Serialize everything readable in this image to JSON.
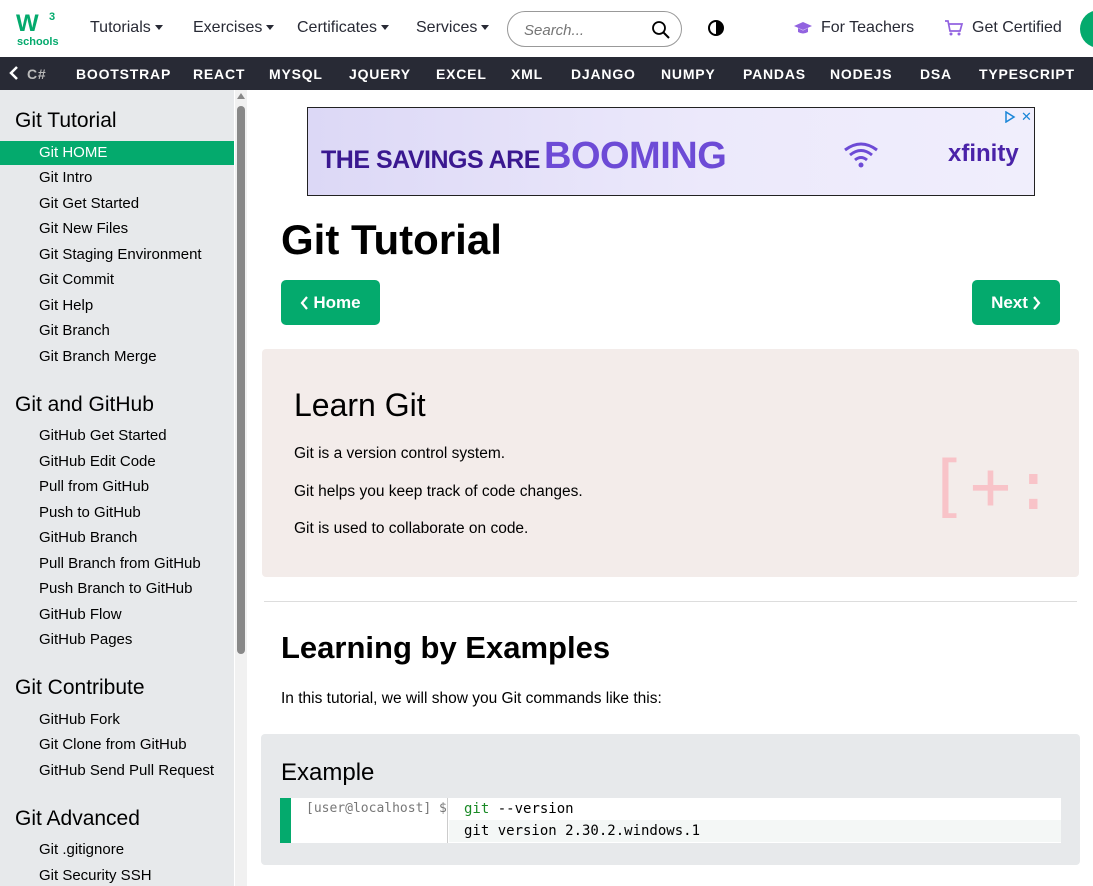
{
  "topnav": {
    "logo_text": "schools",
    "logo_sup": "3",
    "items": [
      {
        "label": "Tutorials"
      },
      {
        "label": "Exercises"
      },
      {
        "label": "Certificates"
      },
      {
        "label": "Services"
      }
    ],
    "search_placeholder": "Search...",
    "for_teachers": "For Teachers",
    "get_certified": "Get Certified"
  },
  "subnav": {
    "items": [
      "C#",
      "BOOTSTRAP",
      "REACT",
      "MYSQL",
      "JQUERY",
      "EXCEL",
      "XML",
      "DJANGO",
      "NUMPY",
      "PANDAS",
      "NODEJS",
      "DSA",
      "TYPESCRIPT"
    ]
  },
  "sidebar": {
    "sections": [
      {
        "heading": "Git Tutorial",
        "items": [
          "Git HOME",
          "Git Intro",
          "Git Get Started",
          "Git New Files",
          "Git Staging Environment",
          "Git Commit",
          "Git Help",
          "Git Branch",
          "Git Branch Merge"
        ]
      },
      {
        "heading": "Git and GitHub",
        "items": [
          "GitHub Get Started",
          "GitHub Edit Code",
          "Pull from GitHub",
          "Push to GitHub",
          "GitHub Branch",
          "Pull Branch from GitHub",
          "Push Branch to GitHub",
          "GitHub Flow",
          "GitHub Pages"
        ]
      },
      {
        "heading": "Git Contribute",
        "items": [
          "GitHub Fork",
          "Git Clone from GitHub",
          "GitHub Send Pull Request"
        ]
      },
      {
        "heading": "Git Advanced",
        "items": [
          "Git .gitignore",
          "Git Security SSH"
        ]
      }
    ],
    "active_item": "Git HOME"
  },
  "ad": {
    "line1": "THE SAVINGS ARE",
    "line2": "BOOMING",
    "brand": "xfinity",
    "close": "✕"
  },
  "main": {
    "title": "Git Tutorial",
    "home_button": "Home",
    "next_button": "Next",
    "learn": {
      "title": "Learn Git",
      "paragraphs": [
        "Git is a version control system.",
        "Git helps you keep track of code changes.",
        "Git is used to collaborate on code."
      ],
      "art": "[+:"
    },
    "examples_heading": "Learning by Examples",
    "intro": "In this tutorial, we will show you Git commands like this:",
    "example": {
      "title": "Example",
      "prompt": "[user@localhost] $",
      "cmd_keyword": "git",
      "cmd_rest": " --version",
      "output": "git version 2.30.2.windows.1"
    }
  },
  "colors": {
    "accent": "#04AA6D",
    "dark_nav": "#282A35",
    "sidebar_bg": "#E7E9EB",
    "learn_bg": "#F3ECEA"
  }
}
